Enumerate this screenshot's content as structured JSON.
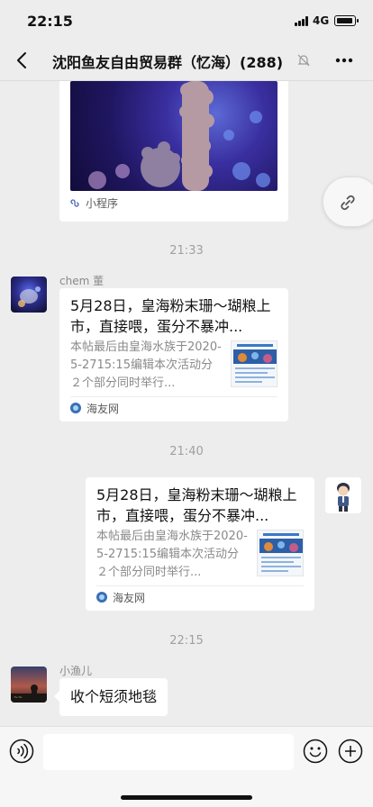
{
  "status_bar": {
    "time": "22:15",
    "network": "4G"
  },
  "header": {
    "title": "沈阳鱼友自由贸易群（忆海）(288)",
    "muted": true
  },
  "messages": {
    "mini_program_card": {
      "label": "小程序"
    },
    "divider_1": "21:33",
    "msg_1": {
      "sender": "chem 董",
      "title": "5月28日，皇海粉末珊～瑚粮上市，直接喂，蛋分不暴冲...",
      "description": "本帖最后由皇海水族于2020-5-2715:15编辑本次活动分２个部分同时举行...",
      "source": "海友网"
    },
    "divider_2": "21:40",
    "msg_2": {
      "title": "5月28日，皇海粉末珊～瑚粮上市，直接喂，蛋分不暴冲...",
      "description": "本帖最后由皇海水族于2020-5-2715:15编辑本次活动分２个部分同时举行...",
      "source": "海友网"
    },
    "divider_3": "22:15",
    "msg_3": {
      "sender": "小渔儿",
      "text": "收个短须地毯"
    }
  },
  "input_bar": {
    "placeholder": ""
  },
  "colors": {
    "background": "#ededed",
    "bubble": "#ffffff",
    "timestamp": "#a0a0a0",
    "source_icon": "#3b6fb6"
  }
}
